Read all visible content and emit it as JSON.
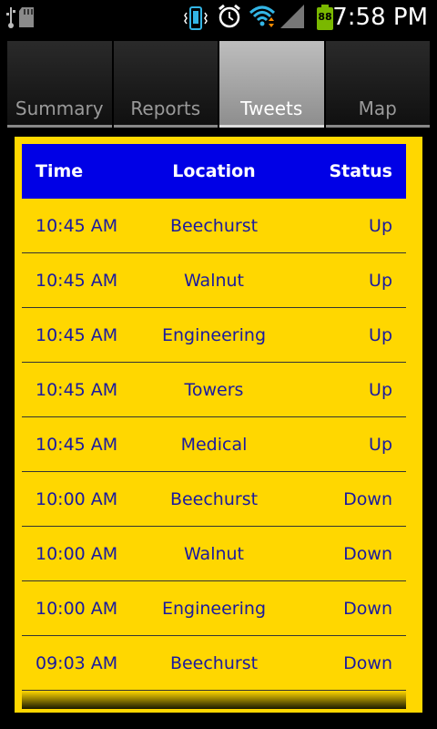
{
  "status_bar": {
    "time": "7:58 PM",
    "battery": "88",
    "icons": [
      "usb-icon",
      "sd-card-icon",
      "vibrate-icon",
      "alarm-icon",
      "wifi-icon",
      "signal-icon",
      "battery-icon"
    ]
  },
  "tabs": [
    {
      "label": "Summary",
      "active": false
    },
    {
      "label": "Reports",
      "active": false
    },
    {
      "label": "Tweets",
      "active": true
    },
    {
      "label": "Map",
      "active": false
    }
  ],
  "table": {
    "headers": {
      "time": "Time",
      "location": "Location",
      "status": "Status"
    },
    "rows": [
      {
        "time": "10:45 AM",
        "location": "Beechurst",
        "status": "Up"
      },
      {
        "time": "10:45 AM",
        "location": "Walnut",
        "status": "Up"
      },
      {
        "time": "10:45 AM",
        "location": "Engineering",
        "status": "Up"
      },
      {
        "time": "10:45 AM",
        "location": "Towers",
        "status": "Up"
      },
      {
        "time": "10:45 AM",
        "location": "Medical",
        "status": "Up"
      },
      {
        "time": "10:00 AM",
        "location": "Beechurst",
        "status": "Down"
      },
      {
        "time": "10:00 AM",
        "location": "Walnut",
        "status": "Down"
      },
      {
        "time": "10:00 AM",
        "location": "Engineering",
        "status": "Down"
      },
      {
        "time": "09:03 AM",
        "location": "Beechurst",
        "status": "Down"
      }
    ]
  },
  "colors": {
    "panel": "#ffd700",
    "header": "#0000e6",
    "row_text": "#1a1aa0",
    "battery": "#7ab800",
    "wifi": "#33b5e5"
  }
}
